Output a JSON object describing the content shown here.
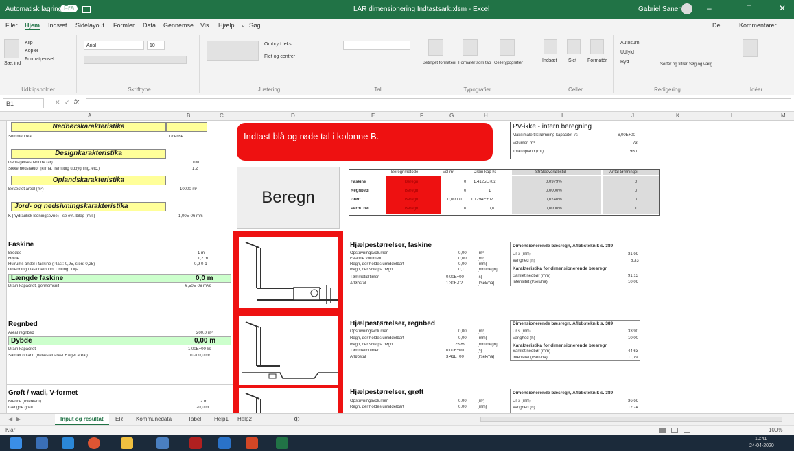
{
  "window": {
    "autosave": "Automatisk lagring",
    "autosave_state": "Fra",
    "title": "LAR dimensionering Indtastsark.xlsm - Excel",
    "user": "Gabriel Saner"
  },
  "menu": {
    "tabs": [
      "Filer",
      "Hjem",
      "Indsæt",
      "Sidelayout",
      "Formler",
      "Data",
      "Gennemse",
      "Vis",
      "Hjælp"
    ],
    "search": "Søg",
    "share": "Del",
    "comments": "Kommentarer"
  },
  "ribbon": {
    "clipboard": {
      "paste": "Sæt ind",
      "cut": "Klip",
      "copy": "Kopiér",
      "format_painter": "Formatpensel",
      "label": "Udklipsholder"
    },
    "font": {
      "name": "Arial",
      "size": "10",
      "label": "Skrifttype"
    },
    "alignment": {
      "wrap": "Ombryd tekst",
      "merge": "Flet og centrer",
      "label": "Justering"
    },
    "number": {
      "label": "Tal"
    },
    "styles": {
      "conditional": "Betinget formatering",
      "table": "Formatér som tabel",
      "cell": "Celletypografier",
      "label": "Typografier"
    },
    "cells": {
      "insert": "Indsæt",
      "delete": "Slet",
      "format": "Formatér",
      "label": "Celler"
    },
    "editing": {
      "autosum": "Autosum",
      "fill": "Udfyld",
      "clear": "Ryd",
      "sort": "Sortér og filtrer",
      "find": "Søg og vælg",
      "label": "Redigering"
    },
    "ideas": {
      "label": "Idéer"
    }
  },
  "formula_bar": {
    "name_box": "B1",
    "content": ""
  },
  "columns": [
    "A",
    "B",
    "C",
    "D",
    "E",
    "F",
    "G",
    "H",
    "I",
    "J",
    "K",
    "L",
    "M"
  ],
  "left": {
    "nedbor_header": "Nedbørskarakteristika",
    "nedbor_rows": [
      {
        "label": "Sommerlokal",
        "value": "Odense"
      }
    ],
    "design_header": "Designkarakteristika",
    "design_rows": [
      {
        "label": "Gentagelsesperiode (år)",
        "value": "100"
      },
      {
        "label": "Sikkerhedsfaktor (klima, fremtidig udbygning, etc.)",
        "value": "1,2"
      }
    ],
    "opland_header": "Oplandskarakteristika",
    "opland_rows": [
      {
        "label": "Befæstet areal (m²)",
        "value": "10000 m²"
      }
    ],
    "jord_header": "Jord- og nedsivningskarakteristika",
    "jord_rows": [
      {
        "label": "K (hydraulisk ledningsevne) - se evt. bilag (m/s)",
        "value": "1,00E-06 m/s"
      }
    ],
    "faskine": {
      "title": "Faskine",
      "rows": [
        {
          "label": "Bredde",
          "value": "1 m"
        },
        {
          "label": "Højde",
          "value": "1,2 m"
        },
        {
          "label": "Hulrums andel i faskine (Plast: 0,95, sten: 0,25)",
          "value": "0,9 0-1"
        },
        {
          "label": "Udledning i faskine/bund: Drilling: 1=ja",
          "value": ""
        }
      ],
      "result_label": "Længde faskine",
      "result_value": "0,0 m",
      "after": [
        {
          "label": "Drain kapacitet, gennemsnit",
          "value": "6,50E-06 m³/s"
        }
      ]
    },
    "regnbed": {
      "title": "Regnbed",
      "rows": [
        {
          "label": "Areal regnbed",
          "value": "200,0 m²"
        }
      ],
      "result_label": "Dybde",
      "result_value": "0,00 m",
      "after": [
        {
          "label": "Drain kapacitet",
          "value": "1,00E+00 l/s"
        },
        {
          "label": "Samlet opland (befæstet areal + eget areal)",
          "value": "10200,0 m²"
        }
      ]
    },
    "grøft": {
      "title": "Grøft / wadi, V-formet",
      "rows": [
        {
          "label": "Bredde (overkant)",
          "value": "2 m"
        },
        {
          "label": "Længde grøft",
          "value": "20,0 m"
        }
      ]
    }
  },
  "banner": {
    "text": "Indtast blå og røde tal i kolonne B."
  },
  "beregn_button": "Beregn",
  "calc_table": {
    "headers": [
      "",
      "Beregnmetode",
      "Vol m³",
      "Drain kap l/s",
      "Stråleoverløbstid",
      "Antal tømninger"
    ],
    "rows": [
      {
        "name": "Faskine",
        "btn": "Beregn",
        "vol": "0",
        "kap": "1,4125E+02",
        "tid": "0,0979%",
        "antal": "0"
      },
      {
        "name": "Regnbed",
        "btn": "Beregn",
        "vol": "0",
        "kap": "1",
        "tid": "0,0000%",
        "antal": "0"
      },
      {
        "name": "Grøft",
        "btn": "Beregn",
        "vol": "0,00001",
        "kap": "1,1294E+02",
        "tid": "0,0740%",
        "antal": "0"
      },
      {
        "name": "Perm. bel.",
        "btn": "Beregn",
        "vol": "0",
        "kap": "0,0",
        "tid": "0,0000%",
        "antal": "1"
      }
    ]
  },
  "pv": {
    "title": "PV-ikke - intern beregning",
    "rows": [
      {
        "label": "Maksimale tilstrømning kapacitet l/s",
        "value": "6,00E+00"
      },
      {
        "label": "Volumen m³",
        "value": "73"
      },
      {
        "label": "Total opland (m²)",
        "value": "960"
      }
    ]
  },
  "hj_faskine": {
    "title": "Hjælpestørrelser, faskine",
    "rows": [
      {
        "label": "Opstuvningsvolumen",
        "value": "0,00",
        "unit": "[m³]"
      },
      {
        "label": "Faskine volumen",
        "value": "0,00",
        "unit": "[m³]"
      },
      {
        "label": "Regn, der holdes umiddelbart",
        "value": "0,00",
        "unit": "[mm]"
      },
      {
        "label": "Regn, der sive på døgn",
        "value": "0,11",
        "unit": "[mm/døgn]"
      },
      {
        "label": "Tømmetid timer",
        "value": "0,00E+00",
        "unit": "[s]"
      },
      {
        "label": "Afløbstal",
        "value": "1,30E-02",
        "unit": "[l/sek/ha]"
      }
    ]
  },
  "hj_regnbed": {
    "title": "Hjælpestørrelser, regnbed",
    "rows": [
      {
        "label": "Opstuvningsvolumen",
        "value": "0,00",
        "unit": "[m³]"
      },
      {
        "label": "Regn, der holdes umiddelbart",
        "value": "0,00",
        "unit": "[mm]"
      },
      {
        "label": "Regn, der sive på døgn",
        "value": "25,89",
        "unit": "[mm/døgn]"
      },
      {
        "label": "Tømmetid timer",
        "value": "0,00E+00",
        "unit": "[s]"
      },
      {
        "label": "Afløbstal",
        "value": "3,41E+00",
        "unit": "[l/sek/ha]"
      }
    ]
  },
  "hj_grøft": {
    "title": "Hjælpestørrelser, grøft",
    "rows": [
      {
        "label": "Opstuvningsvolumen",
        "value": "0,00",
        "unit": "[m³]"
      },
      {
        "label": "Regn, der holdes umiddelbart",
        "value": "0,00",
        "unit": "[mm]"
      }
    ]
  },
  "dim_faskine": {
    "title": "Dimensionerende bæsregn, Afløbsteknik s. 389",
    "rows": [
      {
        "label": "Ur s (mm)",
        "value": "31,66"
      },
      {
        "label": "Varighed (h)",
        "value": "8,33"
      }
    ],
    "title2": "Karakteristika for dimensionerende bæsregn",
    "rows2": [
      {
        "label": "Samlet nedbør (mm)",
        "value": "91,13"
      },
      {
        "label": "Intensitet (l/sek/ha)",
        "value": "10,06"
      }
    ]
  },
  "dim_regnbed": {
    "title": "Dimensionerende bæsregn, Afløbsteknik s. 389",
    "rows": [
      {
        "label": "Ur s (mm)",
        "value": "33,90"
      },
      {
        "label": "Varighed (h)",
        "value": "10,00"
      }
    ],
    "title2": "Karakteristika for dimensionerende bæsregn",
    "rows2": [
      {
        "label": "Samlet nedbør (mm)",
        "value": "44,63"
      },
      {
        "label": "Intensitet (l/sek/ha)",
        "value": "11,79"
      }
    ]
  },
  "dim_grøft": {
    "title": "Dimensionerende bæsregn, Afløbsteknik s. 389",
    "rows": [
      {
        "label": "Ur s (mm)",
        "value": "36,66"
      },
      {
        "label": "Varighed (h)",
        "value": "12,74"
      }
    ]
  },
  "sheets": [
    "Input og resultat",
    "ER",
    "Kommunedata",
    "Tabel",
    "Help1",
    "Help2"
  ],
  "status": {
    "ready": "Klar",
    "zoom": "100%"
  },
  "taskbar": {
    "time": "10:41",
    "date": "24-04-2020"
  },
  "colors": {
    "excel_green": "#217346",
    "red": "#ee1111",
    "yellow": "#ffff99",
    "green_band": "#ccffcc"
  }
}
